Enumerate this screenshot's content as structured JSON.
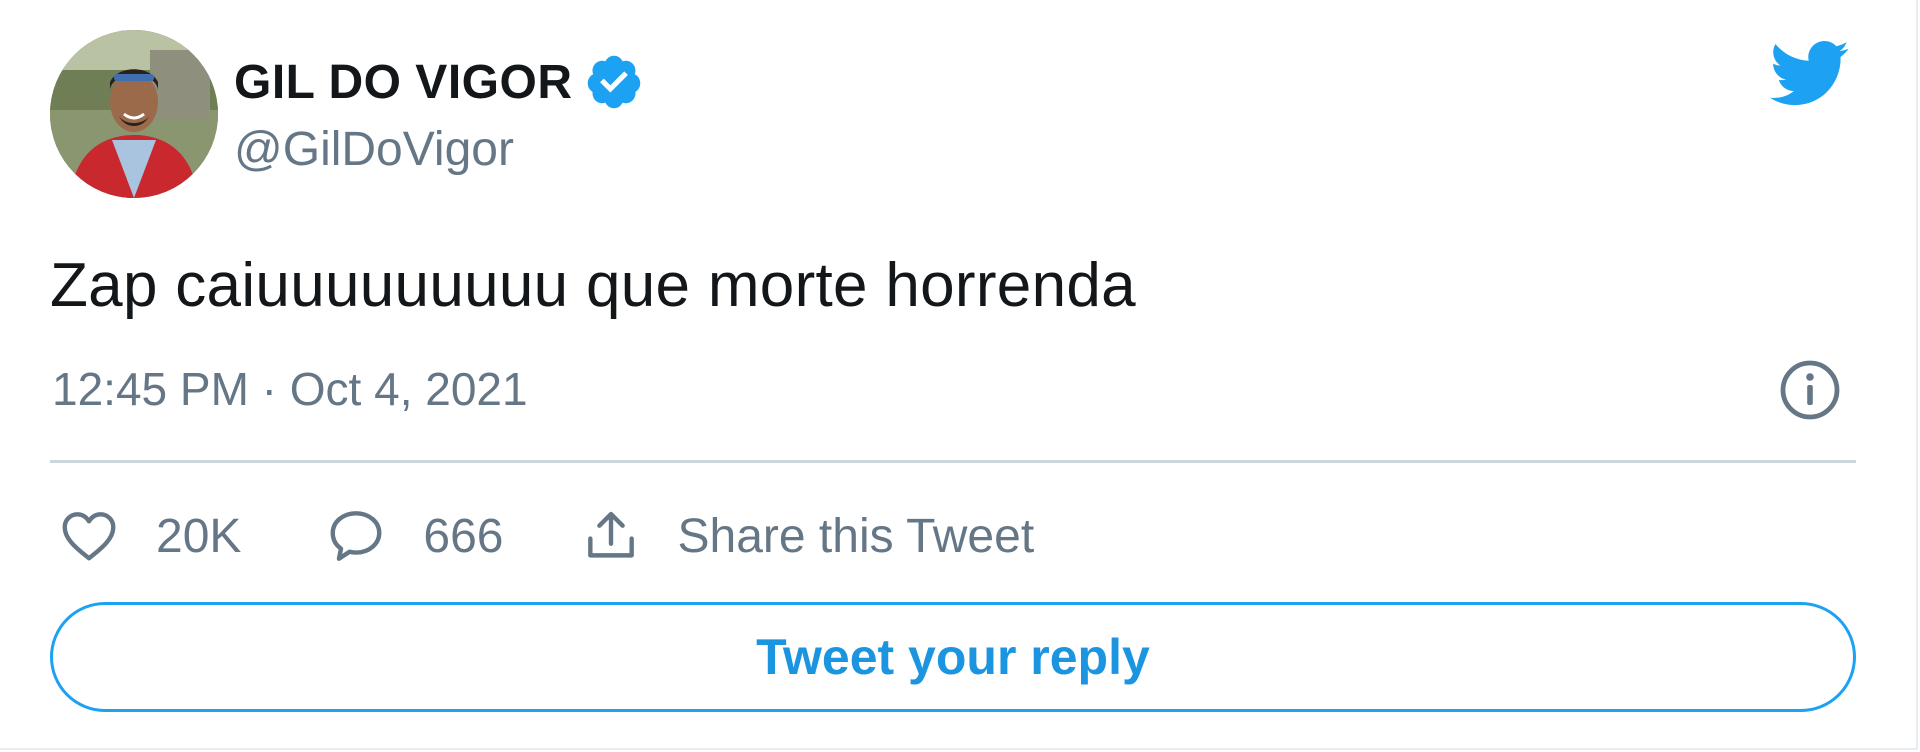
{
  "tweet": {
    "author": {
      "display_name": "GIL DO VIGOR",
      "handle": "@GilDoVigor",
      "verified": true
    },
    "text": "Zap caiuuuuuuuuu que morte horrenda",
    "timestamp": "12:45 PM · Oct 4, 2021"
  },
  "actions": {
    "likes": "20K",
    "replies": "666",
    "share_label": "Share this Tweet"
  },
  "reply_button": {
    "label": "Tweet your reply"
  },
  "icons": {
    "brand": "twitter-bird-icon",
    "verified": "verified-badge-icon",
    "info": "info-icon",
    "like": "heart-icon",
    "reply": "speech-bubble-icon",
    "share": "share-icon"
  },
  "colors": {
    "accent": "#1da1f2",
    "accent_text": "#1b95e0",
    "secondary_text": "#657786",
    "primary_text": "#14171a",
    "divider": "#ccd6dd"
  }
}
